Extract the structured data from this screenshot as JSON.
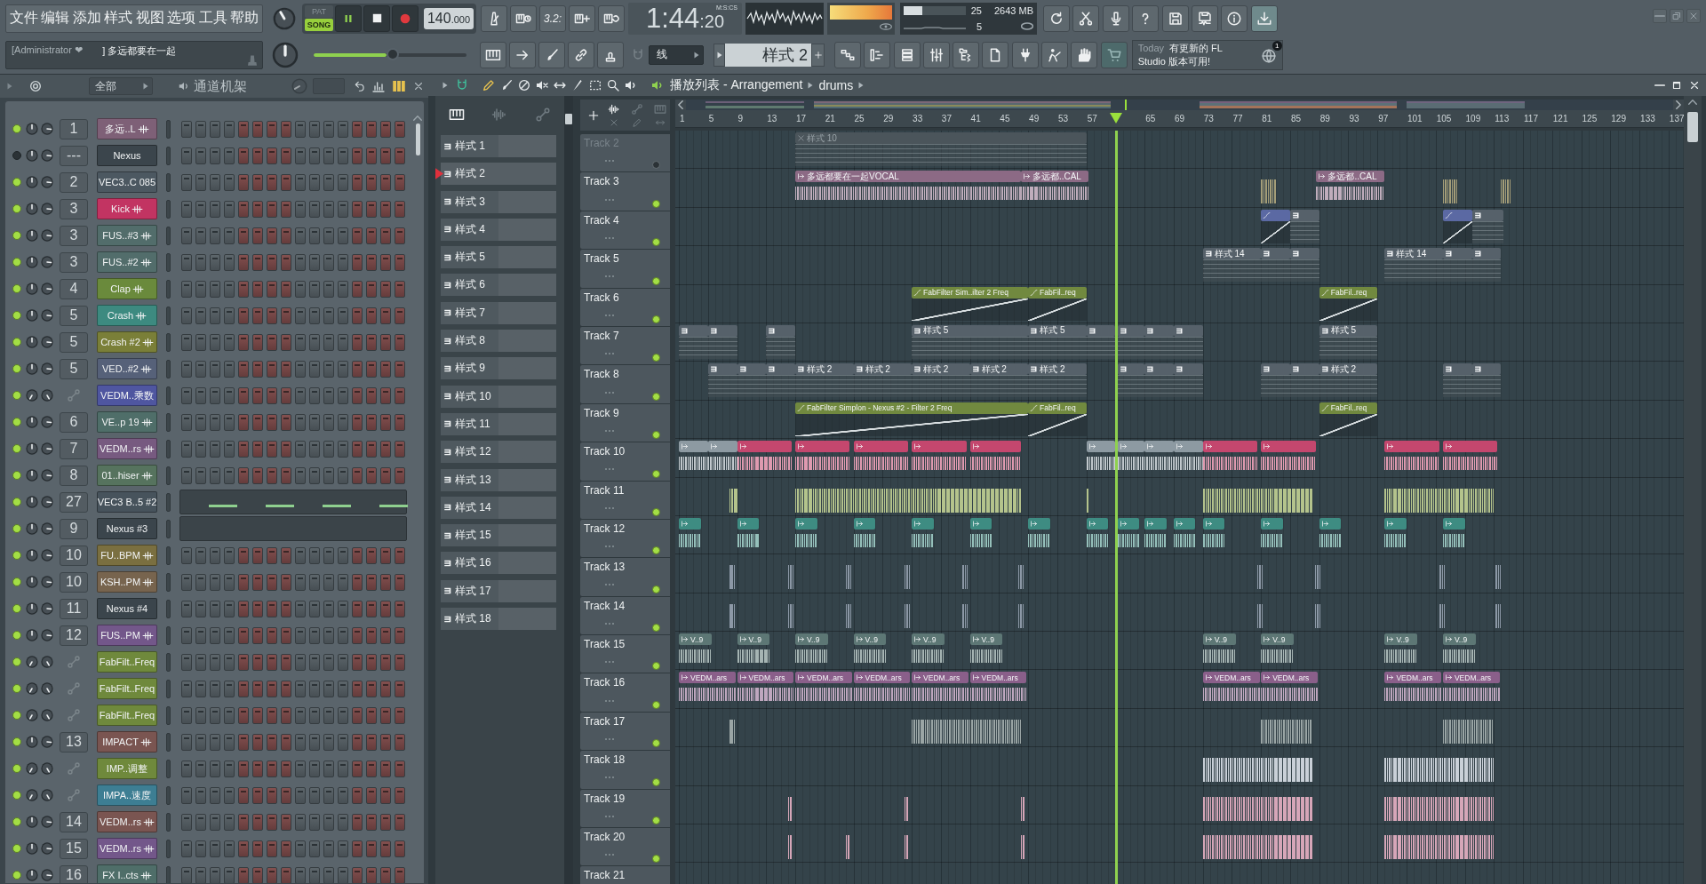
{
  "menu": [
    "文件",
    "编辑",
    "添加",
    "样式",
    "视图",
    "选项",
    "工具",
    "帮助"
  ],
  "transport": {
    "modes": [
      {
        "label": "PAT",
        "selected": false
      },
      {
        "label": "SONG",
        "selected": true
      }
    ],
    "playing": true,
    "tempo": "140",
    "tempo_decimals": ".000"
  },
  "toolbar": {
    "countdown": "3.2:"
  },
  "time": {
    "main": "1:44",
    "centiseconds": ":20",
    "unit": "M:S:CS"
  },
  "master_meter": {
    "level": 1
  },
  "cpu": {
    "level": 0.3,
    "value": "25",
    "memory": "2643 MB",
    "polyphony": "5"
  },
  "hint": {
    "user": "[Administrator ❤",
    "text": "] 多远都要在一起"
  },
  "master_pitch": {
    "level": 0.52
  },
  "snap": "线",
  "pattern_selector": "样式 2",
  "news": {
    "date": "Today",
    "lines": [
      "有更新的 FL",
      "Studio 版本可用!"
    ],
    "badge": "1"
  },
  "channel_rack": {
    "filter": "全部",
    "title": "通道机架",
    "channels": [
      {
        "mixer": "1",
        "name": "多远..L",
        "kind": "sample",
        "enabled": true,
        "color": "#7e6077",
        "piano_roll": false
      },
      {
        "mixer": "---",
        "name": "Nexus",
        "kind": "plugin",
        "enabled": false,
        "color": "#3b454c",
        "piano_roll": false
      },
      {
        "mixer": "2",
        "name": "VEC3..C 085",
        "kind": "plugin",
        "enabled": true,
        "color": "#4c5861",
        "piano_roll": false
      },
      {
        "mixer": "3",
        "name": "Kick",
        "kind": "sample",
        "enabled": true,
        "color": "#c23462",
        "piano_roll": false
      },
      {
        "mixer": "3",
        "name": "FUS..#3",
        "kind": "sample",
        "enabled": true,
        "color": "#526d6b",
        "piano_roll": false
      },
      {
        "mixer": "3",
        "name": "FUS..#2",
        "kind": "sample",
        "enabled": true,
        "color": "#526d6b",
        "piano_roll": false
      },
      {
        "mixer": "4",
        "name": "Clap",
        "kind": "sample",
        "enabled": true,
        "color": "#6a8a3c",
        "piano_roll": false
      },
      {
        "mixer": "5",
        "name": "Crash",
        "kind": "sample",
        "enabled": true,
        "color": "#3d8a80",
        "piano_roll": false
      },
      {
        "mixer": "5",
        "name": "Crash #2",
        "kind": "sample",
        "enabled": true,
        "color": "#7a7f38",
        "piano_roll": false
      },
      {
        "mixer": "5",
        "name": "VED..#2",
        "kind": "sample",
        "enabled": true,
        "color": "#566179",
        "piano_roll": false
      },
      {
        "name": "VEDM..乘数",
        "kind": "automation",
        "enabled": true,
        "color": "#4f56a0",
        "piano_roll": false
      },
      {
        "mixer": "6",
        "name": "VE..p 19",
        "kind": "sample",
        "enabled": true,
        "color": "#4f6e69",
        "piano_roll": false
      },
      {
        "mixer": "7",
        "name": "VEDM..rs",
        "kind": "sample",
        "enabled": true,
        "color": "#775a80",
        "piano_roll": false
      },
      {
        "mixer": "8",
        "name": "01..hiser",
        "kind": "sample",
        "enabled": true,
        "color": "#56735e",
        "piano_roll": false
      },
      {
        "mixer": "27",
        "name": "VEC3 B..5 #2",
        "kind": "plugin",
        "enabled": true,
        "color": "#47535c",
        "piano_roll": true,
        "notes": true
      },
      {
        "mixer": "9",
        "name": "Nexus #3",
        "kind": "plugin",
        "enabled": true,
        "color": "#3b454c",
        "piano_roll": true,
        "notes": false
      },
      {
        "mixer": "10",
        "name": "FU..BPM",
        "kind": "sample",
        "enabled": true,
        "color": "#7a6f40",
        "piano_roll": false
      },
      {
        "mixer": "10",
        "name": "KSH..PM",
        "kind": "sample",
        "enabled": true,
        "color": "#77644e",
        "piano_roll": false
      },
      {
        "mixer": "11",
        "name": "Nexus #4",
        "kind": "plugin",
        "enabled": true,
        "color": "#3b454c",
        "piano_roll": false
      },
      {
        "mixer": "12",
        "name": "FUS..PM",
        "kind": "sample",
        "enabled": true,
        "color": "#73578a",
        "piano_roll": false
      },
      {
        "name": "FabFilt..Freq",
        "kind": "automation",
        "enabled": true,
        "color": "#6f893c",
        "piano_roll": false
      },
      {
        "name": "FabFilt..Freq",
        "kind": "automation",
        "enabled": true,
        "color": "#6f893c",
        "piano_roll": false
      },
      {
        "name": "FabFilt..Freq",
        "kind": "automation",
        "enabled": true,
        "color": "#6f893c",
        "piano_roll": false
      },
      {
        "mixer": "13",
        "name": "IMPACT",
        "kind": "sample",
        "enabled": true,
        "color": "#7a5551",
        "piano_roll": false
      },
      {
        "name": "IMP..调整",
        "kind": "automation",
        "enabled": true,
        "color": "#6f893c",
        "piano_roll": false
      },
      {
        "name": "IMPA..速度",
        "kind": "automation",
        "enabled": true,
        "color": "#3d7e93",
        "piano_roll": false
      },
      {
        "mixer": "14",
        "name": "VEDM..rs",
        "kind": "sample",
        "enabled": true,
        "color": "#7a5551",
        "piano_roll": false
      },
      {
        "mixer": "15",
        "name": "VEDM..rs",
        "kind": "sample",
        "enabled": true,
        "color": "#73578a",
        "piano_roll": false
      },
      {
        "mixer": "16",
        "name": "FX I..cts",
        "kind": "sample",
        "enabled": true,
        "color": "#4f6e69",
        "piano_roll": false
      }
    ]
  },
  "playlist": {
    "title": "播放列表 - Arrangement",
    "breadcrumb": "drums",
    "patterns": [
      {
        "label": "样式 1",
        "selected": false
      },
      {
        "label": "样式 2",
        "selected": true
      },
      {
        "label": "样式 3",
        "selected": false
      },
      {
        "label": "样式 4",
        "selected": false
      },
      {
        "label": "样式 5",
        "selected": false
      },
      {
        "label": "样式 6",
        "selected": false
      },
      {
        "label": "样式 7",
        "selected": false
      },
      {
        "label": "样式 8",
        "selected": false
      },
      {
        "label": "样式 9",
        "selected": false
      },
      {
        "label": "样式 10",
        "selected": false
      },
      {
        "label": "样式 11",
        "selected": false
      },
      {
        "label": "样式 12",
        "selected": false
      },
      {
        "label": "样式 13",
        "selected": false
      },
      {
        "label": "样式 14",
        "selected": false
      },
      {
        "label": "样式 15",
        "selected": false
      },
      {
        "label": "样式 16",
        "selected": false
      },
      {
        "label": "样式 17",
        "selected": false
      },
      {
        "label": "样式 18",
        "selected": false
      }
    ],
    "ruler": [
      "1",
      "5",
      "9",
      "13",
      "17",
      "21",
      "25",
      "29",
      "33",
      "37",
      "41",
      "45",
      "49",
      "53",
      "57",
      "65",
      "69",
      "73",
      "77",
      "81",
      "85",
      "89",
      "93",
      "97",
      "101",
      "105",
      "109",
      "113",
      "117",
      "121",
      "125",
      "129",
      "133",
      "137"
    ],
    "tracks": [
      {
        "name": "Track 2",
        "enabled": false,
        "clips": [
          {
            "kind": "pattern",
            "color": "#4b555b",
            "label": "样式 10"
          }
        ]
      },
      {
        "name": "Track 3",
        "enabled": true,
        "clips": [
          {
            "kind": "audio",
            "color": "#8c6a85",
            "label": "多远都要在一起VOCAL"
          },
          {
            "kind": "audio",
            "color": "#8c6a85",
            "label": "多远都..CAL"
          },
          {
            "kind": "slice",
            "color": "#a49d78"
          },
          {
            "kind": "audio",
            "color": "#8c6a85",
            "label": "多远都..CAL"
          },
          {
            "kind": "slice",
            "color": "#a49d78"
          },
          {
            "kind": "slice",
            "color": "#a49d78"
          }
        ]
      },
      {
        "name": "Track 4",
        "enabled": true,
        "clips": [
          {
            "kind": "automation",
            "color": "#5b69a3"
          },
          {
            "kind": "pattern",
            "color": "#56616a"
          },
          {
            "kind": "automation",
            "color": "#5b69a3"
          },
          {
            "kind": "pattern",
            "color": "#56616a"
          }
        ]
      },
      {
        "name": "Track 5",
        "enabled": true,
        "clips": [
          {
            "kind": "pattern",
            "color": "#56616a",
            "label": "样式 14"
          },
          {
            "kind": "pattern",
            "color": "#56616a"
          },
          {
            "kind": "pattern",
            "color": "#56616a"
          },
          {
            "kind": "pattern",
            "color": "#56616a",
            "label": "样式 14"
          },
          {
            "kind": "pattern",
            "color": "#56616a"
          },
          {
            "kind": "pattern",
            "color": "#56616a"
          }
        ]
      },
      {
        "name": "Track 6",
        "enabled": true,
        "clips": [
          {
            "kind": "automation",
            "color": "#71893f",
            "label": "FabFilter Sim..ilter 2 Freq"
          },
          {
            "kind": "automation",
            "color": "#71893f",
            "label": "FabFil..req"
          },
          {
            "kind": "automation",
            "color": "#71893f",
            "label": "FabFil..req"
          }
        ]
      },
      {
        "name": "Track 7",
        "enabled": true,
        "clips": [
          {
            "kind": "pattern",
            "color": "#56616a"
          },
          {
            "kind": "pattern",
            "color": "#56616a"
          },
          {
            "kind": "pattern",
            "color": "#56616a"
          },
          {
            "kind": "pattern",
            "color": "#56616a",
            "label": "样式 5"
          },
          {
            "kind": "pattern",
            "color": "#56616a",
            "label": "样式 5"
          },
          {
            "kind": "pattern",
            "color": "#56616a"
          },
          {
            "kind": "pattern",
            "color": "#56616a"
          },
          {
            "kind": "pattern",
            "color": "#56616a"
          },
          {
            "kind": "pattern",
            "color": "#56616a"
          },
          {
            "kind": "pattern",
            "color": "#56616a",
            "label": "样式 5"
          }
        ]
      },
      {
        "name": "Track 8",
        "enabled": true,
        "clips": [
          {
            "kind": "pattern",
            "color": "#56616a"
          },
          {
            "kind": "pattern",
            "color": "#56616a"
          },
          {
            "kind": "pattern",
            "color": "#56616a"
          },
          {
            "kind": "pattern",
            "color": "#56616a",
            "label": "样式 2"
          },
          {
            "kind": "pattern",
            "color": "#56616a",
            "label": "样式 2"
          },
          {
            "kind": "pattern",
            "color": "#56616a",
            "label": "样式 2"
          },
          {
            "kind": "pattern",
            "color": "#56616a",
            "label": "样式 2"
          },
          {
            "kind": "pattern",
            "color": "#56616a",
            "label": "样式 2"
          },
          {
            "kind": "pattern",
            "color": "#56616a"
          },
          {
            "kind": "pattern",
            "color": "#56616a"
          },
          {
            "kind": "pattern",
            "color": "#56616a"
          },
          {
            "kind": "pattern",
            "color": "#56616a"
          },
          {
            "kind": "pattern",
            "color": "#56616a"
          },
          {
            "kind": "pattern",
            "color": "#56616a",
            "label": "样式 2"
          },
          {
            "kind": "pattern",
            "color": "#56616a"
          },
          {
            "kind": "pattern",
            "color": "#56616a"
          }
        ]
      },
      {
        "name": "Track 9",
        "enabled": true,
        "clips": [
          {
            "kind": "automation",
            "color": "#71893f",
            "label": "FabFilter Simplon - Nexus #2 - Filter 2 Freq"
          },
          {
            "kind": "automation",
            "color": "#71893f",
            "label": "FabFil..req"
          },
          {
            "kind": "automation",
            "color": "#71893f",
            "label": "FabFil..req"
          }
        ]
      },
      {
        "name": "Track 10",
        "enabled": true,
        "clips": [
          {
            "kind": "audio",
            "color": "#8d9aa2"
          },
          {
            "kind": "audio",
            "color": "#8d9aa2"
          },
          {
            "kind": "audio",
            "color": "#c4476e"
          },
          {
            "kind": "audio",
            "color": "#c4476e"
          },
          {
            "kind": "audio",
            "color": "#c4476e"
          },
          {
            "kind": "audio",
            "color": "#c4476e"
          },
          {
            "kind": "audio",
            "color": "#c4476e"
          },
          {
            "kind": "audio",
            "color": "#8d9aa2"
          },
          {
            "kind": "audio",
            "color": "#8d9aa2"
          },
          {
            "kind": "audio",
            "color": "#8d9aa2"
          },
          {
            "kind": "audio",
            "color": "#8d9aa2"
          },
          {
            "kind": "audio",
            "color": "#c4476e"
          },
          {
            "kind": "audio",
            "color": "#c4476e"
          },
          {
            "kind": "audio",
            "color": "#c4476e"
          },
          {
            "kind": "audio",
            "color": "#c4476e"
          }
        ]
      },
      {
        "name": "Track 11",
        "enabled": true,
        "clips": [
          {
            "kind": "slice",
            "color": "#b4c38c"
          },
          {
            "kind": "slice",
            "color": "#b4c38c"
          },
          {
            "kind": "slice",
            "color": "#b4c38c"
          },
          {
            "kind": "slice",
            "color": "#b4c38c"
          },
          {
            "kind": "slice",
            "color": "#b4c38c"
          }
        ]
      },
      {
        "name": "Track 12",
        "enabled": true,
        "clips": [
          {
            "kind": "audio",
            "color": "#3e8c82"
          },
          {
            "kind": "audio",
            "color": "#3e8c82"
          },
          {
            "kind": "audio",
            "color": "#3e8c82"
          },
          {
            "kind": "audio",
            "color": "#3e8c82"
          },
          {
            "kind": "audio",
            "color": "#3e8c82"
          },
          {
            "kind": "audio",
            "color": "#3e8c82"
          },
          {
            "kind": "audio",
            "color": "#3e8c82"
          },
          {
            "kind": "audio",
            "color": "#3e8c82"
          },
          {
            "kind": "audio",
            "color": "#3e8c82"
          },
          {
            "kind": "audio",
            "color": "#3e8c82"
          },
          {
            "kind": "audio",
            "color": "#3e8c82"
          },
          {
            "kind": "audio",
            "color": "#3e8c82"
          },
          {
            "kind": "audio",
            "color": "#3e8c82"
          },
          {
            "kind": "audio",
            "color": "#3e8c82"
          },
          {
            "kind": "audio",
            "color": "#3e8c82"
          },
          {
            "kind": "audio",
            "color": "#3e8c82"
          }
        ]
      },
      {
        "name": "Track 13",
        "enabled": true,
        "clips": [
          {
            "kind": "slice",
            "color": "#8c98a6"
          },
          {
            "kind": "slice",
            "color": "#8c98a6"
          },
          {
            "kind": "slice",
            "color": "#8c98a6"
          },
          {
            "kind": "slice",
            "color": "#8c98a6"
          },
          {
            "kind": "slice",
            "color": "#8c98a6"
          },
          {
            "kind": "slice",
            "color": "#8c98a6"
          },
          {
            "kind": "slice",
            "color": "#8c98a6"
          },
          {
            "kind": "slice",
            "color": "#8c98a6"
          },
          {
            "kind": "slice",
            "color": "#8c98a6"
          },
          {
            "kind": "slice",
            "color": "#8c98a6"
          }
        ]
      },
      {
        "name": "Track 14",
        "enabled": true,
        "clips": [
          {
            "kind": "slice",
            "color": "#8c98a6"
          },
          {
            "kind": "slice",
            "color": "#8c98a6"
          },
          {
            "kind": "slice",
            "color": "#8c98a6"
          },
          {
            "kind": "slice",
            "color": "#8c98a6"
          },
          {
            "kind": "slice",
            "color": "#8c98a6"
          },
          {
            "kind": "slice",
            "color": "#8c98a6"
          },
          {
            "kind": "slice",
            "color": "#8c98a6"
          },
          {
            "kind": "slice",
            "color": "#8c98a6"
          },
          {
            "kind": "slice",
            "color": "#8c98a6"
          },
          {
            "kind": "slice",
            "color": "#8c98a6"
          }
        ]
      },
      {
        "name": "Track 15",
        "enabled": true,
        "clips": [
          {
            "kind": "audio",
            "color": "#5d7775",
            "label": "V..9"
          },
          {
            "kind": "audio",
            "color": "#5d7775",
            "label": "V..9"
          },
          {
            "kind": "audio",
            "color": "#5d7775",
            "label": "V..9"
          },
          {
            "kind": "audio",
            "color": "#5d7775",
            "label": "V..9"
          },
          {
            "kind": "audio",
            "color": "#5d7775",
            "label": "V..9"
          },
          {
            "kind": "audio",
            "color": "#5d7775",
            "label": "V..9"
          },
          {
            "kind": "audio",
            "color": "#5d7775",
            "label": "V..9"
          },
          {
            "kind": "audio",
            "color": "#5d7775",
            "label": "V..9"
          },
          {
            "kind": "audio",
            "color": "#5d7775",
            "label": "V..9"
          },
          {
            "kind": "audio",
            "color": "#5d7775",
            "label": "V..9"
          }
        ]
      },
      {
        "name": "Track 16",
        "enabled": true,
        "clips": [
          {
            "kind": "audio",
            "color": "#8a5f8a",
            "label": "VEDM..ars"
          },
          {
            "kind": "audio",
            "color": "#8a5f8a",
            "label": "VEDM..ars"
          },
          {
            "kind": "audio",
            "color": "#8a5f8a",
            "label": "VEDM..ars"
          },
          {
            "kind": "audio",
            "color": "#8a5f8a",
            "label": "VEDM..ars"
          },
          {
            "kind": "audio",
            "color": "#8a5f8a",
            "label": "VEDM..ars"
          },
          {
            "kind": "audio",
            "color": "#8a5f8a",
            "label": "VEDM..ars"
          },
          {
            "kind": "audio",
            "color": "#8a5f8a",
            "label": "VEDM..ars"
          },
          {
            "kind": "audio",
            "color": "#8a5f8a",
            "label": "VEDM..ars"
          },
          {
            "kind": "audio",
            "color": "#8a5f8a",
            "label": "VEDM..ars"
          },
          {
            "kind": "audio",
            "color": "#8a5f8a",
            "label": "VEDM..ars"
          }
        ]
      },
      {
        "name": "Track 17",
        "enabled": true,
        "clips": [
          {
            "kind": "slice",
            "color": "#9aa5a5"
          },
          {
            "kind": "slice",
            "color": "#9aa5a5"
          },
          {
            "kind": "slice",
            "color": "#9aa5a5"
          },
          {
            "kind": "slice",
            "color": "#9aa5a5"
          }
        ]
      },
      {
        "name": "Track 18",
        "enabled": true,
        "clips": [
          {
            "kind": "slice",
            "color": "#c9d0d8"
          },
          {
            "kind": "slice",
            "color": "#c9d0d8"
          }
        ]
      },
      {
        "name": "Track 19",
        "enabled": true,
        "clips": [
          {
            "kind": "slice",
            "color": "#d6a6b8"
          },
          {
            "kind": "slice",
            "color": "#d6a6b8"
          },
          {
            "kind": "slice",
            "color": "#d6a6b8"
          },
          {
            "kind": "slice",
            "color": "#d6a6b8"
          },
          {
            "kind": "slice",
            "color": "#d6a6b8"
          }
        ]
      },
      {
        "name": "Track 20",
        "enabled": true,
        "clips": [
          {
            "kind": "slice",
            "color": "#d6a6b8"
          },
          {
            "kind": "slice",
            "color": "#d6a6b8"
          },
          {
            "kind": "slice",
            "color": "#d6a6b8"
          },
          {
            "kind": "slice",
            "color": "#d6a6b8"
          },
          {
            "kind": "slice",
            "color": "#d6a6b8"
          },
          {
            "kind": "slice",
            "color": "#d6a6b8"
          }
        ]
      },
      {
        "name": "Track 21"
      }
    ]
  }
}
